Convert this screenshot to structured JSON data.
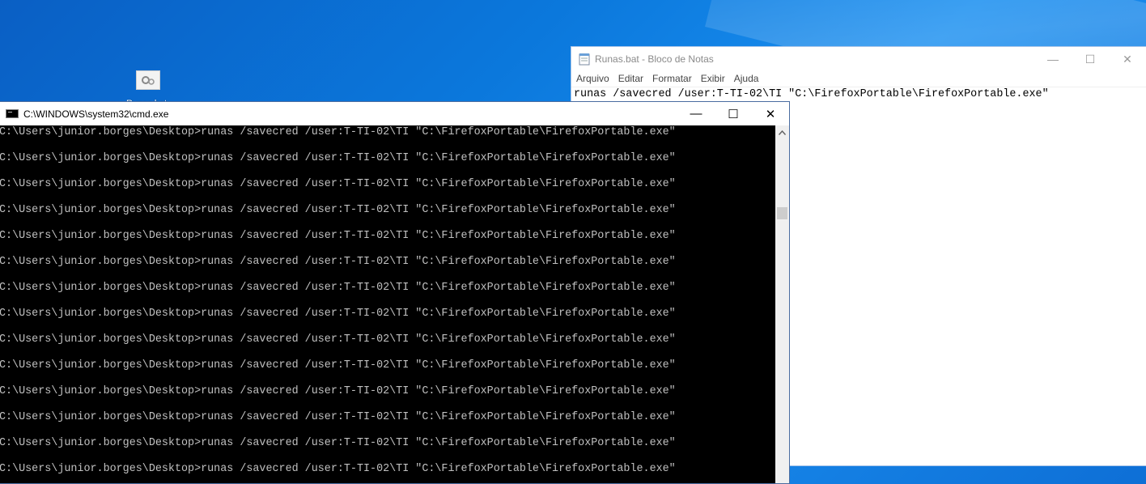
{
  "desktop": {
    "icon_name": "gear-settings-icon",
    "icon_label": "Runas.bat"
  },
  "notepad": {
    "title": "Runas.bat - Bloco de Notas",
    "menu": [
      "Arquivo",
      "Editar",
      "Formatar",
      "Exibir",
      "Ajuda"
    ],
    "content": "runas /savecred /user:T-TI-02\\TI \"C:\\FirefoxPortable\\FirefoxPortable.exe\"",
    "controls": {
      "minimize": "—",
      "maximize": "☐",
      "close": "✕"
    }
  },
  "cmd": {
    "title": "C:\\WINDOWS\\system32\\cmd.exe",
    "controls": {
      "minimize": "—",
      "maximize": "☐",
      "close": "✕"
    },
    "lines": [
      "C:\\Users\\junior.borges\\Desktop>runas /savecred /user:T-TI-02\\TI \"C:\\FirefoxPortable\\FirefoxPortable.exe\"",
      "C:\\Users\\junior.borges\\Desktop>runas /savecred /user:T-TI-02\\TI \"C:\\FirefoxPortable\\FirefoxPortable.exe\"",
      "C:\\Users\\junior.borges\\Desktop>runas /savecred /user:T-TI-02\\TI \"C:\\FirefoxPortable\\FirefoxPortable.exe\"",
      "C:\\Users\\junior.borges\\Desktop>runas /savecred /user:T-TI-02\\TI \"C:\\FirefoxPortable\\FirefoxPortable.exe\"",
      "C:\\Users\\junior.borges\\Desktop>runas /savecred /user:T-TI-02\\TI \"C:\\FirefoxPortable\\FirefoxPortable.exe\"",
      "C:\\Users\\junior.borges\\Desktop>runas /savecred /user:T-TI-02\\TI \"C:\\FirefoxPortable\\FirefoxPortable.exe\"",
      "C:\\Users\\junior.borges\\Desktop>runas /savecred /user:T-TI-02\\TI \"C:\\FirefoxPortable\\FirefoxPortable.exe\"",
      "C:\\Users\\junior.borges\\Desktop>runas /savecred /user:T-TI-02\\TI \"C:\\FirefoxPortable\\FirefoxPortable.exe\"",
      "C:\\Users\\junior.borges\\Desktop>runas /savecred /user:T-TI-02\\TI \"C:\\FirefoxPortable\\FirefoxPortable.exe\"",
      "C:\\Users\\junior.borges\\Desktop>runas /savecred /user:T-TI-02\\TI \"C:\\FirefoxPortable\\FirefoxPortable.exe\"",
      "C:\\Users\\junior.borges\\Desktop>runas /savecred /user:T-TI-02\\TI \"C:\\FirefoxPortable\\FirefoxPortable.exe\"",
      "C:\\Users\\junior.borges\\Desktop>runas /savecred /user:T-TI-02\\TI \"C:\\FirefoxPortable\\FirefoxPortable.exe\"",
      "C:\\Users\\junior.borges\\Desktop>runas /savecred /user:T-TI-02\\TI \"C:\\FirefoxPortable\\FirefoxPortable.exe\"",
      "C:\\Users\\junior.borges\\Desktop>runas /savecred /user:T-TI-02\\TI \"C:\\FirefoxPortable\\FirefoxPortable.exe\""
    ]
  },
  "colors": {
    "desktop_blue": "#0b78dc",
    "console_text": "#c0c0c0",
    "console_bg": "#000000"
  }
}
